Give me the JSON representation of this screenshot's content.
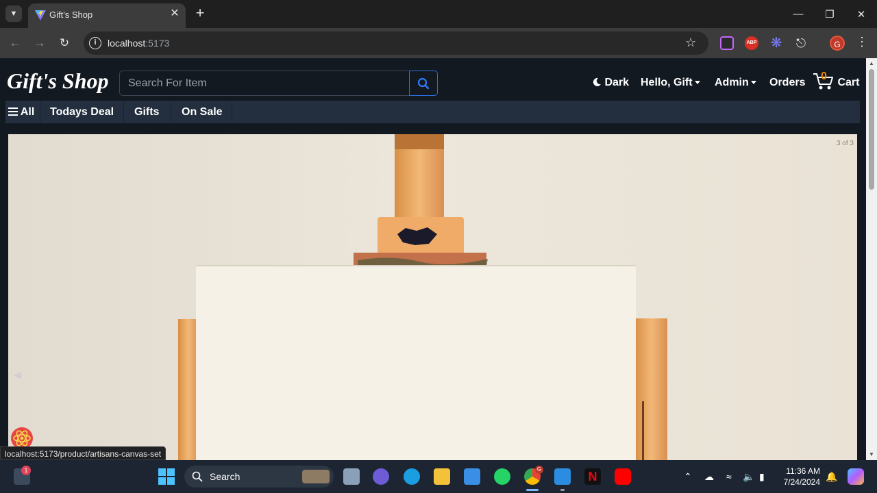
{
  "browser": {
    "tab_title": "Gift's Shop",
    "url_host": "localhost",
    "url_port": ":5173",
    "profile_initial": "G"
  },
  "header": {
    "logo": "Gift's Shop",
    "search_placeholder": "Search For Item",
    "dark_label": "Dark",
    "greeting": "Hello, Gift",
    "admin_label": "Admin",
    "orders_label": "Orders",
    "cart_count": "0",
    "cart_label": "Cart"
  },
  "nav": {
    "all_label": "All",
    "items": [
      "Todays Deal",
      "Gifts",
      "On Sale"
    ]
  },
  "carousel": {
    "counter": "3 of 3",
    "current_slide": 3,
    "total_slides": 3
  },
  "status_bar": {
    "link": "localhost:5173/product/artisans-canvas-set"
  },
  "taskbar": {
    "search_label": "Search",
    "notification_badge": "1",
    "chrome_badge": "G",
    "time": "11:36 AM",
    "date": "7/24/2024"
  },
  "colors": {
    "page_bg": "#131921",
    "nav_bg": "#232f3e",
    "accent_orange": "#f08804",
    "search_accent": "#2f6fdc"
  },
  "icons": [
    "search-icon",
    "moon-icon",
    "cart-icon",
    "hamburger-icon",
    "star-icon",
    "react-icon"
  ]
}
